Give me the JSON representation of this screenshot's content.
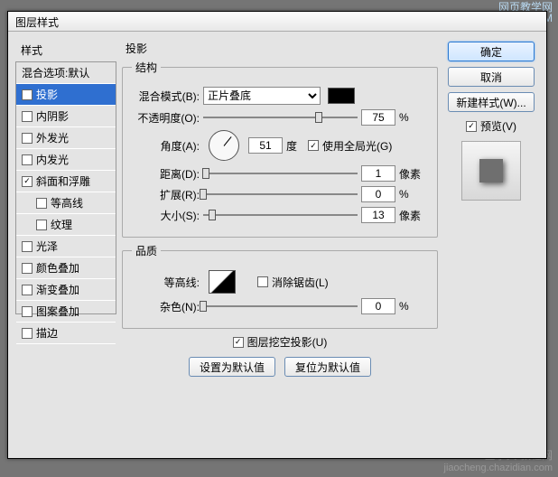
{
  "watermark": {
    "site": "网页教学网",
    "url": "WWW.WEBJX.COM",
    "bottom1": "查字典 教程网",
    "bottom2": "jiaocheng.chazidian.com"
  },
  "window": {
    "title": "图层样式"
  },
  "sidebar": {
    "header": "样式",
    "items": [
      {
        "label": "混合选项:默认",
        "checked": null
      },
      {
        "label": "投影",
        "checked": true,
        "selected": true
      },
      {
        "label": "内阴影",
        "checked": false
      },
      {
        "label": "外发光",
        "checked": false
      },
      {
        "label": "内发光",
        "checked": false
      },
      {
        "label": "斜面和浮雕",
        "checked": true
      },
      {
        "label": "等高线",
        "checked": false,
        "indent": true
      },
      {
        "label": "纹理",
        "checked": false,
        "indent": true
      },
      {
        "label": "光泽",
        "checked": false
      },
      {
        "label": "颜色叠加",
        "checked": false
      },
      {
        "label": "渐变叠加",
        "checked": false
      },
      {
        "label": "图案叠加",
        "checked": false
      },
      {
        "label": "描边",
        "checked": false
      }
    ]
  },
  "panel": {
    "title": "投影",
    "structure": {
      "legend": "结构",
      "blend_label": "混合模式(B):",
      "blend_value": "正片叠底",
      "color": "#000000",
      "opacity_label": "不透明度(O):",
      "opacity_value": "75",
      "opacity_unit": "%",
      "angle_label": "角度(A):",
      "angle_value": "51",
      "angle_unit": "度",
      "global_checked": true,
      "global_label": "使用全局光(G)",
      "distance_label": "距离(D):",
      "distance_value": "1",
      "distance_unit": "像素",
      "spread_label": "扩展(R):",
      "spread_value": "0",
      "spread_unit": "%",
      "size_label": "大小(S):",
      "size_value": "13",
      "size_unit": "像素"
    },
    "quality": {
      "legend": "品质",
      "contour_label": "等高线:",
      "antialias_checked": false,
      "antialias_label": "消除锯齿(L)",
      "noise_label": "杂色(N):",
      "noise_value": "0",
      "noise_unit": "%"
    },
    "footer": {
      "knockout_checked": true,
      "knockout_label": "图层挖空投影(U)",
      "make_default": "设置为默认值",
      "reset_default": "复位为默认值"
    }
  },
  "buttons": {
    "ok": "确定",
    "cancel": "取消",
    "newstyle": "新建样式(W)...",
    "preview_checked": true,
    "preview_label": "预览(V)"
  }
}
